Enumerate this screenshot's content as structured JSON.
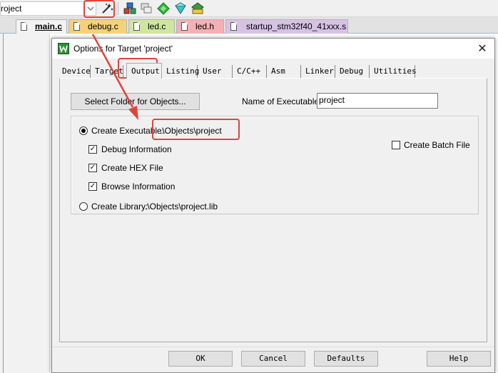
{
  "toolbar": {
    "target_value": "roject",
    "icons": [
      "chevron-down-icon",
      "magic-wand-icon",
      "component-icon",
      "stack-icon",
      "green-gem-icon",
      "diamond-down-icon",
      "pack-installer-icon"
    ]
  },
  "file_tabs": [
    {
      "label": "main.c",
      "color": "#e6e6e6",
      "active": true
    },
    {
      "label": "debug.c",
      "color": "#f5d27a"
    },
    {
      "label": "led.c",
      "color": "#cfe6a0"
    },
    {
      "label": "led.h",
      "color": "#f4b0b5"
    },
    {
      "label": "startup_stm32f40_41xxx.s",
      "color": "#d7c2e6"
    }
  ],
  "dialog": {
    "title": "Options for Target 'project'",
    "close_glyph": "✕",
    "tabs": [
      "Device",
      "Target",
      "Output",
      "Listing",
      "User",
      "C/C++",
      "Asm",
      "Linker",
      "Debug",
      "Utilities"
    ],
    "active_tab": "Output",
    "select_folder_label": "Select Folder for Objects...",
    "exe_name_label": "Name of Executable:",
    "exe_name_value": "project",
    "create_exe_label": "Create Executable:",
    "create_exe_path": ".\\Objects\\project",
    "debug_info_label": "Debug Information",
    "create_hex_label": "Create HEX File",
    "browse_info_label": "Browse Information",
    "create_batch_label": "Create Batch File",
    "create_lib_label": "Create Library:",
    "create_lib_path": ".\\Objects\\project.lib",
    "check_glyph": "✓",
    "ok_label": "OK",
    "cancel_label": "Cancel",
    "defaults_label": "Defaults",
    "help_label": "Help"
  },
  "annotation_color": "#e0453b"
}
